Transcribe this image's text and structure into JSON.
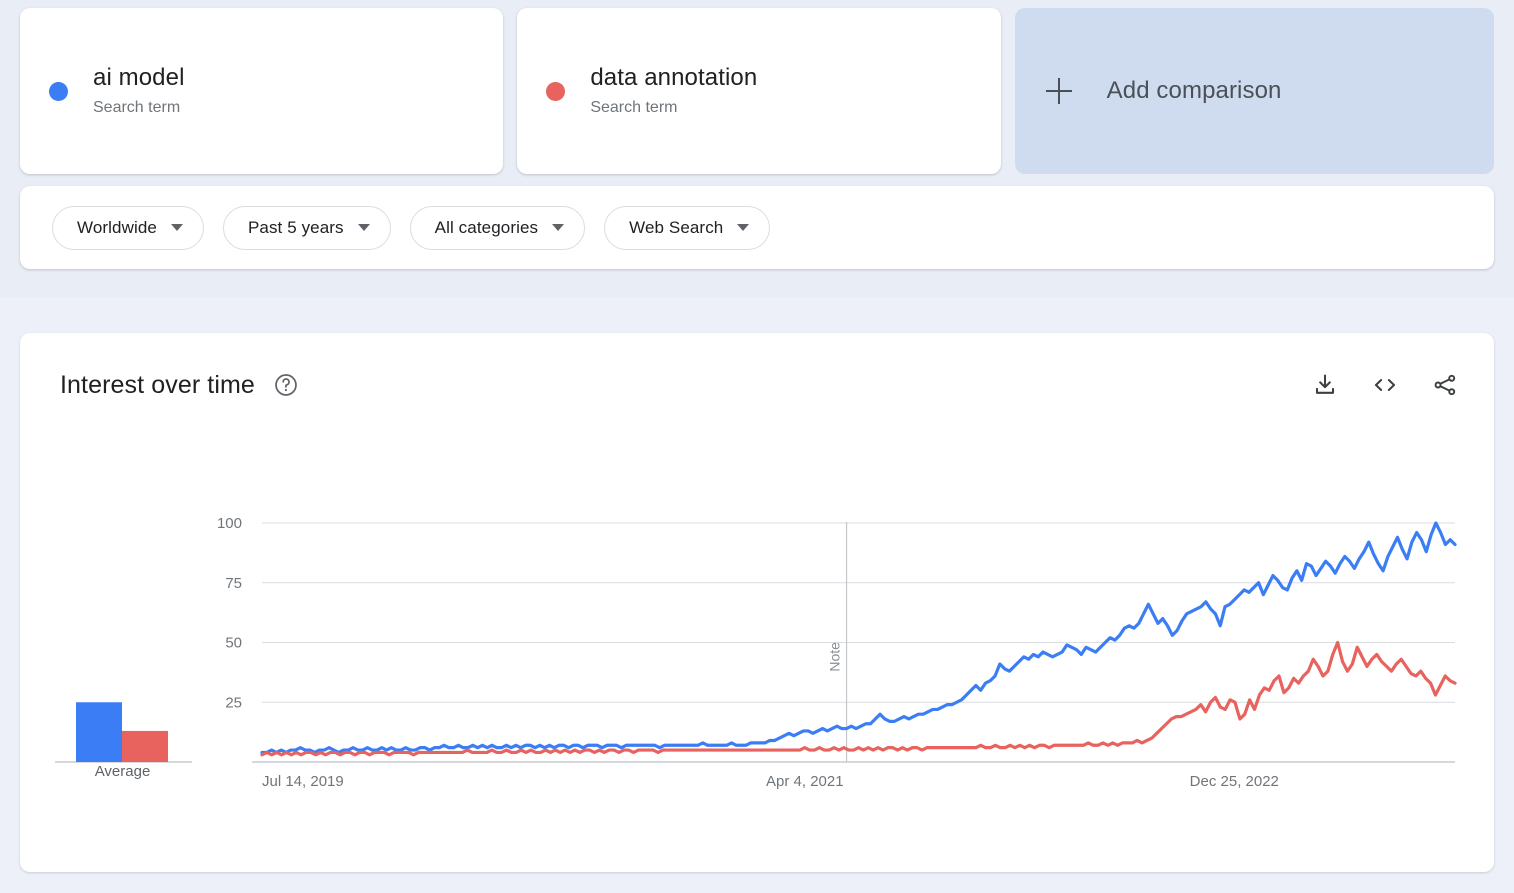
{
  "terms": [
    {
      "name": "ai model",
      "type": "Search term",
      "color": "#3B7DF5",
      "dot": "series-dot-blue"
    },
    {
      "name": "data annotation",
      "type": "Search term",
      "color": "#E8625E",
      "dot": "series-dot-red"
    }
  ],
  "add_comparison": {
    "label": "Add comparison",
    "icon": "plus-icon"
  },
  "filters": [
    {
      "label": "Worldwide",
      "name": "location-filter"
    },
    {
      "label": "Past 5 years",
      "name": "time-range-filter"
    },
    {
      "label": "All categories",
      "name": "category-filter"
    },
    {
      "label": "Web Search",
      "name": "search-type-filter"
    }
  ],
  "chart_panel": {
    "title": "Interest over time",
    "help_icon": "help-circle-icon",
    "actions": [
      {
        "name": "download-icon",
        "label": "Download"
      },
      {
        "name": "embed-code-icon",
        "label": "Embed"
      },
      {
        "name": "share-icon",
        "label": "Share"
      }
    ]
  },
  "average_panel": {
    "label": "Average",
    "values": [
      25,
      13
    ]
  },
  "chart_data": {
    "type": "line",
    "title": "Interest over time",
    "xlabel": "",
    "ylabel": "",
    "ylim": [
      0,
      100
    ],
    "yticks": [
      25,
      50,
      75,
      100
    ],
    "grid": true,
    "legend": "cards-above",
    "xtick_labels": [
      "Jul 14, 2019",
      "Apr 4, 2021",
      "Dec 25, 2022"
    ],
    "xtick_positions": [
      0,
      0.455,
      0.815
    ],
    "annotations": [
      {
        "label": "Note",
        "x_fraction": 0.49,
        "orientation": "vertical"
      }
    ],
    "series": [
      {
        "name": "ai model",
        "color": "#3B7DF5",
        "values": [
          4,
          4,
          5,
          4,
          5,
          4,
          5,
          5,
          6,
          5,
          5,
          4,
          5,
          5,
          6,
          5,
          4,
          5,
          5,
          6,
          5,
          5,
          6,
          5,
          5,
          6,
          5,
          6,
          5,
          5,
          6,
          5,
          5,
          6,
          6,
          5,
          6,
          6,
          7,
          6,
          6,
          7,
          6,
          6,
          7,
          6,
          7,
          6,
          7,
          6,
          6,
          7,
          6,
          7,
          6,
          7,
          7,
          6,
          7,
          6,
          7,
          6,
          7,
          7,
          6,
          7,
          7,
          6,
          7,
          7,
          7,
          6,
          7,
          7,
          7,
          6,
          7,
          7,
          7,
          7,
          7,
          7,
          7,
          6,
          7,
          7,
          7,
          7,
          7,
          7,
          7,
          7,
          8,
          7,
          7,
          7,
          7,
          7,
          8,
          7,
          7,
          7,
          8,
          8,
          8,
          8,
          9,
          9,
          10,
          11,
          12,
          11,
          12,
          13,
          13,
          12,
          13,
          14,
          13,
          14,
          15,
          14,
          14,
          15,
          14,
          15,
          16,
          16,
          18,
          20,
          18,
          17,
          17,
          18,
          19,
          18,
          19,
          20,
          20,
          21,
          22,
          22,
          23,
          24,
          24,
          25,
          26,
          28,
          30,
          32,
          30,
          33,
          34,
          36,
          41,
          39,
          38,
          40,
          42,
          44,
          43,
          45,
          44,
          46,
          45,
          44,
          45,
          46,
          49,
          48,
          47,
          45,
          48,
          47,
          46,
          48,
          50,
          52,
          51,
          53,
          56,
          57,
          56,
          58,
          62,
          66,
          62,
          58,
          60,
          57,
          53,
          55,
          59,
          62,
          63,
          64,
          65,
          67,
          64,
          62,
          57,
          65,
          66,
          68,
          70,
          72,
          71,
          73,
          75,
          70,
          74,
          78,
          76,
          73,
          72,
          77,
          80,
          76,
          83,
          82,
          78,
          81,
          84,
          82,
          79,
          83,
          86,
          84,
          81,
          85,
          88,
          92,
          87,
          83,
          80,
          86,
          90,
          94,
          89,
          85,
          92,
          96,
          93,
          88,
          95,
          100,
          96,
          91,
          93,
          91
        ]
      },
      {
        "name": "data annotation",
        "color": "#E8625E",
        "values": [
          3,
          4,
          3,
          4,
          3,
          4,
          3,
          4,
          3,
          4,
          4,
          3,
          4,
          3,
          4,
          4,
          3,
          4,
          4,
          3,
          4,
          4,
          3,
          4,
          4,
          4,
          3,
          4,
          4,
          4,
          4,
          3,
          4,
          4,
          4,
          4,
          4,
          4,
          4,
          4,
          4,
          4,
          5,
          4,
          4,
          4,
          4,
          5,
          4,
          4,
          5,
          4,
          4,
          5,
          4,
          5,
          4,
          4,
          5,
          4,
          5,
          4,
          5,
          4,
          5,
          4,
          5,
          5,
          4,
          5,
          4,
          5,
          5,
          4,
          5,
          5,
          4,
          5,
          5,
          5,
          5,
          4,
          5,
          5,
          5,
          5,
          5,
          5,
          5,
          5,
          5,
          5,
          5,
          5,
          5,
          5,
          5,
          5,
          5,
          5,
          5,
          5,
          5,
          5,
          5,
          5,
          5,
          5,
          5,
          5,
          5,
          6,
          5,
          5,
          6,
          5,
          5,
          6,
          5,
          6,
          5,
          5,
          6,
          5,
          6,
          5,
          6,
          5,
          6,
          6,
          5,
          6,
          5,
          6,
          6,
          5,
          6,
          6,
          6,
          6,
          6,
          6,
          6,
          6,
          6,
          6,
          6,
          7,
          6,
          6,
          7,
          6,
          6,
          7,
          6,
          7,
          6,
          7,
          6,
          7,
          7,
          6,
          7,
          7,
          7,
          7,
          7,
          7,
          7,
          8,
          7,
          7,
          8,
          7,
          8,
          7,
          8,
          8,
          8,
          9,
          8,
          9,
          10,
          12,
          14,
          16,
          18,
          19,
          19,
          20,
          21,
          22,
          24,
          21,
          25,
          27,
          23,
          22,
          26,
          25,
          18,
          20,
          26,
          22,
          28,
          31,
          30,
          34,
          36,
          29,
          31,
          35,
          33,
          36,
          38,
          43,
          40,
          36,
          38,
          45,
          50,
          42,
          38,
          41,
          48,
          44,
          40,
          43,
          45,
          42,
          40,
          38,
          41,
          43,
          40,
          37,
          36,
          38,
          35,
          33,
          28,
          32,
          36,
          34,
          33
        ]
      }
    ]
  }
}
